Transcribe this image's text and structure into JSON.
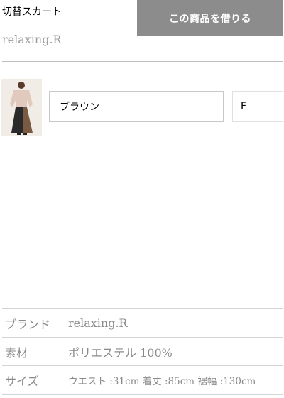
{
  "product": {
    "title": "切替スカート",
    "brand": "relaxing.R"
  },
  "actions": {
    "rent_label": "この商品を借りる"
  },
  "variant": {
    "image_alt": "product-thumbnail",
    "color": "ブラウン",
    "size": "F"
  },
  "specs": [
    {
      "label": "ブランド",
      "value": "relaxing.R"
    },
    {
      "label": "素材",
      "value": "ポリエステル 100%"
    },
    {
      "label": "サイズ",
      "value": "ウエスト :31cm 着丈 :85cm 裾幅 :130cm"
    }
  ],
  "colors": {
    "button_bg": "#8c8c8c",
    "muted_text": "#999999",
    "divider": "#bdbdbd"
  }
}
